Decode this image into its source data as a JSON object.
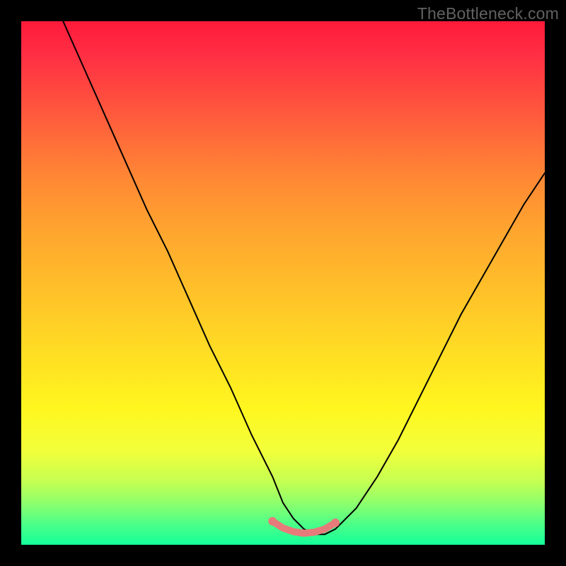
{
  "watermark": "TheBottleneck.com",
  "chart_data": {
    "type": "line",
    "title": "",
    "xlabel": "",
    "ylabel": "",
    "xlim": [
      0,
      100
    ],
    "ylim": [
      0,
      100
    ],
    "series": [
      {
        "name": "black-v-curve",
        "color": "#000000",
        "x": [
          8,
          12,
          16,
          20,
          24,
          28,
          32,
          36,
          40,
          44,
          48,
          50,
          52,
          54,
          56,
          58,
          60,
          64,
          68,
          72,
          76,
          80,
          84,
          88,
          92,
          96,
          100
        ],
        "y": [
          100,
          91,
          82,
          73,
          64,
          56,
          47,
          38,
          30,
          21,
          13,
          8,
          5,
          3,
          2,
          2,
          3,
          7,
          13,
          20,
          28,
          36,
          44,
          51,
          58,
          65,
          71
        ]
      },
      {
        "name": "red-bottom-segment",
        "color": "#e77a7a",
        "x": [
          48,
          50,
          52,
          54,
          56,
          58,
          60
        ],
        "y": [
          4.5,
          3.2,
          2.5,
          2.2,
          2.4,
          3.0,
          4.2
        ]
      }
    ],
    "background_gradient": {
      "top": "#ff1a3a",
      "mid": "#ffdf23",
      "bottom": "#14ff99"
    }
  }
}
